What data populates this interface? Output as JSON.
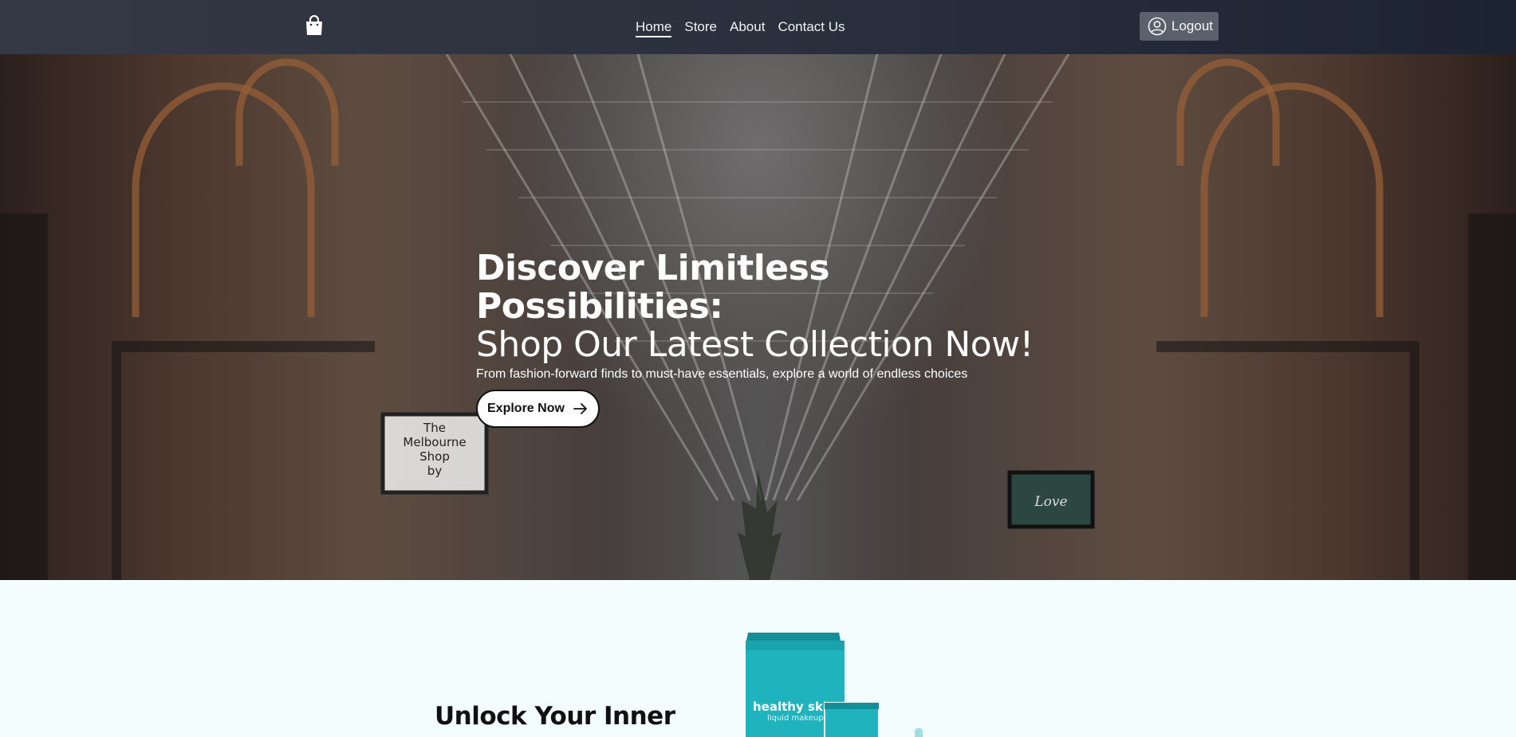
{
  "nav": {
    "logo_icon": "shopping-bag-icon",
    "links": [
      "Home",
      "Store",
      "About",
      "Contact Us"
    ],
    "active": "Home",
    "logout_label": "Logout",
    "logout_icon": "user-circle-icon"
  },
  "hero": {
    "title_line1": "Discover Limitless Possibilities:",
    "title_line2": "Shop Our Latest Collection Now!",
    "subtitle": "From fashion-forward finds to must-have essentials, explore a world of endless choices",
    "cta_label": "Explore Now",
    "cta_icon": "arrow-right-icon",
    "signs": {
      "left": [
        "The",
        "Melbourne",
        "Shop",
        "by"
      ],
      "right": "Love"
    }
  },
  "section2": {
    "heading": "Unlock Your Inner",
    "product": {
      "label": "healthy skin",
      "sublabel": "liquid makeup"
    }
  },
  "colors": {
    "nav_bg_start": "#353945",
    "nav_bg_end": "#1c2333",
    "logout_bg": "#5b616c",
    "product_teal": "#1fb3bd",
    "section_bg": "#f3fdfd"
  }
}
